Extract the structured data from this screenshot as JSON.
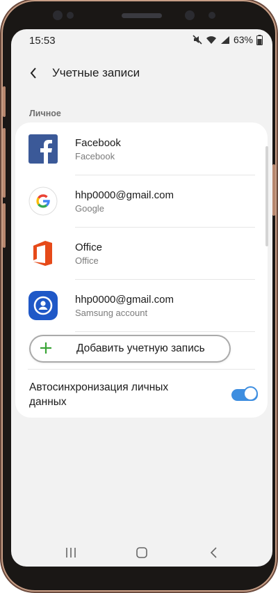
{
  "status": {
    "time": "15:53",
    "battery": "63%"
  },
  "header": {
    "title": "Учетные записи"
  },
  "section_label": "Личное",
  "accounts": [
    {
      "name": "Facebook",
      "type": "Facebook",
      "icon": "facebook-icon"
    },
    {
      "name": "hhp0000@gmail.com",
      "type": "Google",
      "icon": "google-icon"
    },
    {
      "name": "Office",
      "type": "Office",
      "icon": "office-icon"
    },
    {
      "name": "hhp0000@gmail.com",
      "type": "Samsung account",
      "icon": "samsung-account-icon"
    }
  ],
  "add_account_label": "Добавить учетную запись",
  "sync": {
    "label": "Автосинхронизация личных данных",
    "enabled": true
  },
  "colors": {
    "accent": "#3e8ee0",
    "facebook": "#3b5998",
    "office": "#e64a19",
    "samsung": "#1f58c7",
    "plus": "#3aa537"
  }
}
